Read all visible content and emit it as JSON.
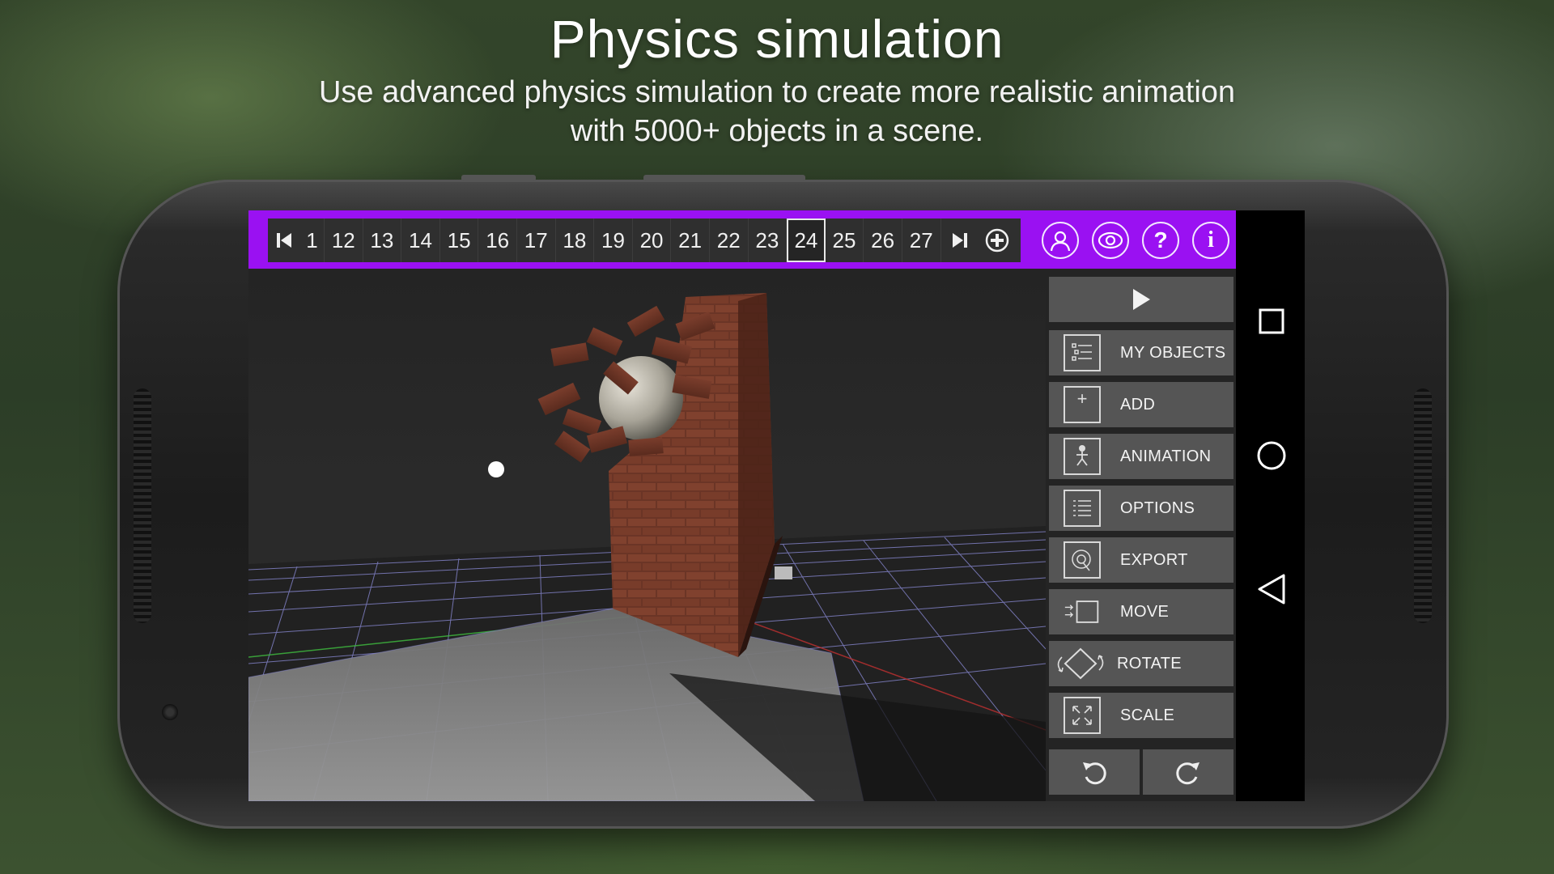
{
  "promo": {
    "title": "Physics simulation",
    "subtitle_line1": "Use advanced physics simulation to create more realistic animation",
    "subtitle_line2": "with 5000+ objects in a scene."
  },
  "timeline": {
    "frames": [
      "1",
      "12",
      "13",
      "14",
      "15",
      "16",
      "17",
      "18",
      "19",
      "20",
      "21",
      "22",
      "23",
      "24",
      "25",
      "26",
      "27"
    ],
    "active_frame": "24"
  },
  "toolbar_icons": [
    "user-icon",
    "eye-icon",
    "help-icon",
    "info-icon"
  ],
  "toolbar_glyphs": {
    "help": "?",
    "info": "i"
  },
  "menu": {
    "items": [
      {
        "label": "MY OBJECTS",
        "icon": "objects-list-icon"
      },
      {
        "label": "ADD",
        "icon": "add-icon"
      },
      {
        "label": "ANIMATION",
        "icon": "animation-icon"
      },
      {
        "label": "OPTIONS",
        "icon": "options-icon"
      },
      {
        "label": "EXPORT",
        "icon": "export-icon"
      },
      {
        "label": "MOVE",
        "icon": "move-icon"
      },
      {
        "label": "ROTATE",
        "icon": "rotate-icon"
      },
      {
        "label": "SCALE",
        "icon": "scale-icon"
      }
    ],
    "add_glyph": "+"
  },
  "colors": {
    "accent": "#9a11f2",
    "menu_button": "#555555",
    "viewport": "#2d2d2d"
  }
}
